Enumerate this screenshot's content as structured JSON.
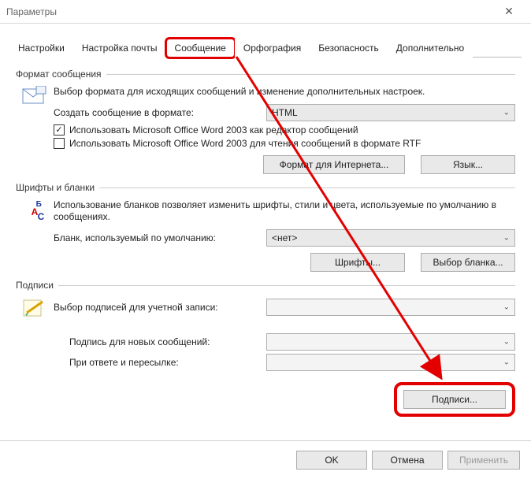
{
  "window": {
    "title": "Параметры"
  },
  "tabs": [
    "Настройки",
    "Настройка почты",
    "Сообщение",
    "Орфография",
    "Безопасность",
    "Дополнительно"
  ],
  "active_tab_index": 2,
  "format": {
    "group": "Формат сообщения",
    "desc": "Выбор формата для исходящих сообщений и изменение дополнительных настроек.",
    "create_label": "Создать сообщение в формате:",
    "create_value": "HTML",
    "cb1_checked": true,
    "cb1": "Использовать Microsoft Office Word 2003 как редактор сообщений",
    "cb2_checked": false,
    "cb2": "Использовать Microsoft Office Word 2003 для чтения сообщений в формате RTF",
    "btn_internet": "Формат для Интернета...",
    "btn_lang": "Язык..."
  },
  "fonts": {
    "group": "Шрифты и бланки",
    "desc": "Использование бланков позволяет изменить шрифты, стили и цвета, используемые по умолчанию в сообщениях.",
    "blank_label": "Бланк, используемый по умолчанию:",
    "blank_value": "<нет>",
    "btn_fonts": "Шрифты...",
    "btn_blank": "Выбор бланка..."
  },
  "sign": {
    "group": "Подписи",
    "acct_label": "Выбор подписей для учетной записи:",
    "new_label": "Подпись для новых сообщений:",
    "reply_label": "При ответе и пересылке:",
    "btn_sign": "Подписи..."
  },
  "footer": {
    "ok": "OK",
    "cancel": "Отмена",
    "apply": "Применить"
  }
}
